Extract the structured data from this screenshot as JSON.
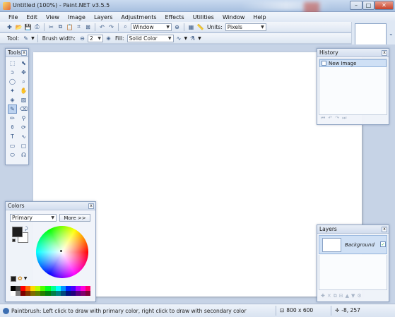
{
  "window": {
    "title": "Untitled (100%) - Paint.NET v3.5.5",
    "minimize_glyph": "–",
    "maximize_glyph": "□",
    "close_glyph": "✕"
  },
  "menu": [
    "File",
    "Edit",
    "View",
    "Image",
    "Layers",
    "Adjustments",
    "Effects",
    "Utilities",
    "Window",
    "Help"
  ],
  "toolbar": {
    "zoom_value": "Window",
    "units_label": "Units:",
    "units_value": "Pixels",
    "tool_label": "Tool:",
    "brush_width_label": "Brush width:",
    "brush_width_value": "2",
    "fill_label": "Fill:",
    "fill_value": "Solid Color"
  },
  "tools_panel": {
    "title": "Tools",
    "close_glyph": "x",
    "tools": [
      {
        "name": "rectangle-select-icon",
        "glyph": "⬚"
      },
      {
        "name": "move-selection-icon",
        "glyph": "⬉"
      },
      {
        "name": "lasso-select-icon",
        "glyph": "ↄ"
      },
      {
        "name": "move-selected-icon",
        "glyph": "✥"
      },
      {
        "name": "ellipse-select-icon",
        "glyph": "◯"
      },
      {
        "name": "zoom-icon",
        "glyph": "⌕"
      },
      {
        "name": "magic-wand-icon",
        "glyph": "✦"
      },
      {
        "name": "pan-icon",
        "glyph": "✋"
      },
      {
        "name": "paint-bucket-icon",
        "glyph": "◈"
      },
      {
        "name": "gradient-icon",
        "glyph": "▨"
      },
      {
        "name": "paintbrush-icon",
        "glyph": "✎"
      },
      {
        "name": "eraser-icon",
        "glyph": "⌫"
      },
      {
        "name": "pencil-icon",
        "glyph": "✏"
      },
      {
        "name": "color-picker-icon",
        "glyph": "⚲"
      },
      {
        "name": "clone-stamp-icon",
        "glyph": "⚱"
      },
      {
        "name": "recolor-icon",
        "glyph": "⟳"
      },
      {
        "name": "text-icon",
        "glyph": "T"
      },
      {
        "name": "line-curve-icon",
        "glyph": "∿"
      },
      {
        "name": "rectangle-icon",
        "glyph": "▭"
      },
      {
        "name": "rounded-rectangle-icon",
        "glyph": "▢"
      },
      {
        "name": "ellipse-icon",
        "glyph": "⬭"
      },
      {
        "name": "freeform-shape-icon",
        "glyph": "☊"
      }
    ],
    "active_tool": "paintbrush-icon"
  },
  "history_panel": {
    "title": "History",
    "close_glyph": "x",
    "items": [
      "New Image"
    ],
    "controls": [
      "⏮",
      "↶",
      "↷",
      "⏭"
    ]
  },
  "colors_panel": {
    "title": "Colors",
    "close_glyph": "x",
    "selector_value": "Primary",
    "more_button": "More >>",
    "primary_color": "#1e1e1e",
    "secondary_color": "#ffffff",
    "palette": [
      "#000000",
      "#404040",
      "#ff0000",
      "#ff6a00",
      "#ffd800",
      "#b6ff00",
      "#4cff00",
      "#00ff21",
      "#00ff90",
      "#00ffff",
      "#0094ff",
      "#0026ff",
      "#4800ff",
      "#b200ff",
      "#ff00dc",
      "#ff006e",
      "#ffffff",
      "#808080",
      "#7f0000",
      "#7f3300",
      "#7f6a00",
      "#5b7f00",
      "#267f00",
      "#007f0e",
      "#007f46",
      "#007f7f",
      "#004a7f",
      "#00137f",
      "#21007f",
      "#57007f",
      "#7f006e",
      "#7f0037"
    ]
  },
  "layers_panel": {
    "title": "Layers",
    "close_glyph": "x",
    "layers": [
      {
        "name": "Background",
        "visible": true
      }
    ],
    "controls": [
      "✚",
      "✕",
      "⧉",
      "⊟",
      "▲",
      "▼",
      "⚙"
    ]
  },
  "status": {
    "message": "Paintbrush: Left click to draw with primary color, right click to draw with secondary color",
    "image_size": "800 x 600",
    "cursor_position": "-8, 257"
  }
}
